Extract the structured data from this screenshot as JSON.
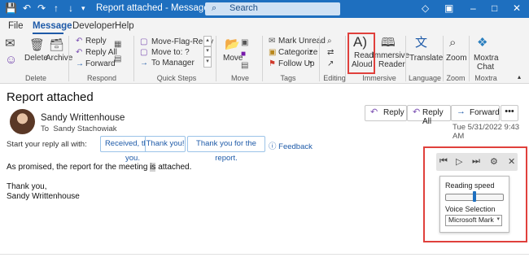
{
  "titlebar": {
    "title": "Report attached - Message (HTML)",
    "search_placeholder": "Search"
  },
  "menu": {
    "file": "File",
    "message": "Message",
    "developer": "Developer",
    "help": "Help"
  },
  "ribbon": {
    "delete": "Delete",
    "archive": "Archive",
    "reply": "Reply",
    "reply_all": "Reply All",
    "forward": "Forward",
    "qs_move_flag_reply": "Move-Flag-Reply",
    "qs_move_to": "Move to: ?",
    "qs_to_manager": "To Manager",
    "move": "Move",
    "mark_unread": "Mark Unread",
    "categorize": "Categorize",
    "follow_up": "Follow Up",
    "read_aloud": [
      "Read",
      "Aloud"
    ],
    "immersive_reader": [
      "Immersive",
      "Reader"
    ],
    "translate": "Translate",
    "zoom": "Zoom",
    "moxtra_chat": [
      "Moxtra",
      "Chat"
    ],
    "groups": {
      "delete": "Delete",
      "respond": "Respond",
      "quick_steps": "Quick Steps",
      "move": "Move",
      "tags": "Tags",
      "editing": "Editing",
      "immersive": "Immersive",
      "language": "Language",
      "zoom": "Zoom",
      "moxtra": "Moxtra"
    }
  },
  "message": {
    "subject": "Report attached",
    "sender": "Sandy Writtenhouse",
    "to_label": "To",
    "to": "Sandy Stachowiak",
    "actions": {
      "reply": "Reply",
      "reply_all": "Reply All",
      "forward": "Forward",
      "more": "•••"
    },
    "date": "Tue 5/31/2022 9:43 AM",
    "start_reply": "Start your reply all with:",
    "suggestions": [
      "Received, thank you.",
      "Thank you!",
      "Thank you for the report."
    ],
    "feedback": "Feedback",
    "body_before": "As promised, the report for the meeting ",
    "body_hl": "is",
    "body_after": " attached.",
    "closing": "Thank you,",
    "signature": "Sandy Writtenhouse"
  },
  "read_aloud": {
    "controls": {
      "previous": "⏮",
      "play": "▷",
      "next": "⏭",
      "settings": "⚙",
      "close": "✕"
    },
    "reading_speed_label": "Reading speed",
    "reading_speed": 0.5,
    "voice_label": "Voice Selection",
    "voice_value": "Microsoft Mark"
  },
  "colors": {
    "title_blue": "#1e6fbf",
    "accent": "#1e5aa8",
    "highlight_red": "#e0403c"
  }
}
